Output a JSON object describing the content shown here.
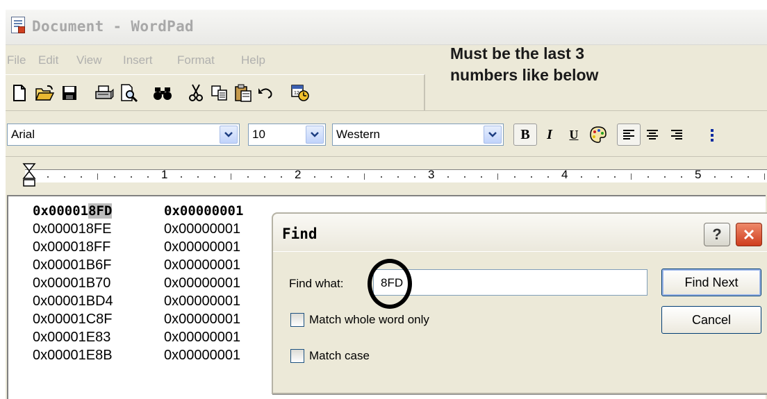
{
  "window": {
    "title": "Document - WordPad",
    "menu": [
      "File",
      "Edit",
      "View",
      "Insert",
      "Format",
      "Help"
    ]
  },
  "toolbar": {
    "icons": [
      "new-document-icon",
      "open-folder-icon",
      "save-icon",
      "print-icon",
      "print-preview-icon",
      "find-icon",
      "cut-icon",
      "copy-icon",
      "paste-icon",
      "undo-icon",
      "date-time-icon"
    ]
  },
  "format_bar": {
    "font": "Arial",
    "size": "10",
    "script": "Western",
    "bold_label": "B",
    "italic_label": "I",
    "underline_label": "U",
    "align_icons": [
      "align-left-icon",
      "align-center-icon",
      "align-right-icon",
      "bullets-icon"
    ]
  },
  "ruler": {
    "labels": [
      "1",
      "2",
      "3",
      "4",
      "5"
    ]
  },
  "annotation": {
    "line1": "Must be the last 3",
    "line2": "numbers like below"
  },
  "document": {
    "first_row": {
      "col1_prefix": "0x00001",
      "col1_highlight": "8FD",
      "col2": "0x00000001"
    },
    "rows": [
      {
        "col1": "0x000018FE",
        "col2": "0x00000001"
      },
      {
        "col1": "0x000018FF",
        "col2": "0x00000001"
      },
      {
        "col1": "0x00001B6F",
        "col2": "0x00000001"
      },
      {
        "col1": "0x00001B70",
        "col2": "0x00000001"
      },
      {
        "col1": "0x00001BD4",
        "col2": "0x00000001"
      },
      {
        "col1": "0x00001C8F",
        "col2": "0x00000001"
      },
      {
        "col1": "0x00001E83",
        "col2": "0x00000001"
      },
      {
        "col1": "0x00001E8B",
        "col2": "0x00000001"
      }
    ]
  },
  "find_dialog": {
    "title": "Find",
    "help_label": "?",
    "find_what_label": "Find what:",
    "find_what_value": "8FD",
    "match_whole_word_label": "Match whole word only",
    "match_whole_word_checked": false,
    "match_case_label": "Match case",
    "match_case_checked": false,
    "find_next_label": "Find Next",
    "cancel_label": "Cancel"
  },
  "colors": {
    "titlebar_text": "#a8a8a8",
    "dialog_bg": "#ece9d8",
    "close_button": "#cf3d1e",
    "highlight": "#bdbdbd"
  }
}
